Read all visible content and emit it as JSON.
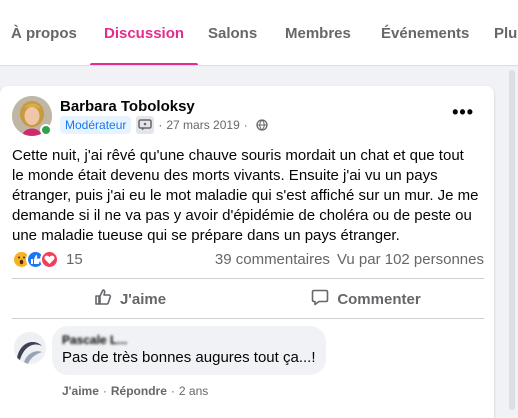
{
  "tabs": [
    {
      "label": "À propos",
      "active": false
    },
    {
      "label": "Discussion",
      "active": true
    },
    {
      "label": "Salons",
      "active": false
    },
    {
      "label": "Membres",
      "active": false
    },
    {
      "label": "Événements",
      "active": false
    },
    {
      "label": "Plus",
      "active": false
    }
  ],
  "accent_color": "#e42c8f",
  "post": {
    "author": "Barbara Toboloksy",
    "role_badge": "Modérateur",
    "sep": "·",
    "date": "27 mars 2019",
    "privacy_icon": "globe-icon",
    "more_label": "•••",
    "text": "Cette nuit, j'ai rêvé qu'une chauve souris mordait un chat et que tout\nle monde était devenu des morts vivants. Ensuite j'ai vu un pays\nétranger, puis j'ai eu le mot maladie qui s'est affiché sur un mur. Je me\ndemande si il ne va pas y avoir  d'épidémie de choléra ou de peste ou\nune maladie tueuse qui se prépare dans un pays étranger.",
    "reactions": [
      "wow",
      "like",
      "love"
    ],
    "reaction_count": "15",
    "comments_count": "39 commentaires",
    "views_count": "Vu par 102 personnes",
    "like_label": "J'aime",
    "comment_label": "Commenter"
  },
  "comment": {
    "author": "Pascale L...",
    "text": "Pas de très bonnes augures tout ça...!",
    "like_label": "J'aime",
    "sep": "·",
    "reply_label": "Répondre",
    "time": "2 ans"
  }
}
